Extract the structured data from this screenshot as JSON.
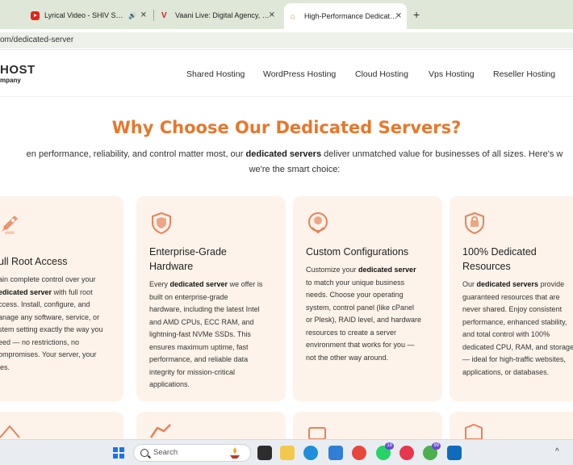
{
  "browser": {
    "tabs": [
      {
        "title": "Lyrical Video - SHIV SE GOR",
        "favicon": "youtube-icon",
        "audio": true
      },
      {
        "title": "Vaani Live: Digital Agency, Web",
        "favicon": "vaani-icon"
      },
      {
        "title": "High-Performance Dedicated S",
        "favicon": "site-icon",
        "active": true
      }
    ],
    "url": "om/dedicated-server"
  },
  "site": {
    "logo": "HOST",
    "logo_sub": "mpany",
    "nav": [
      "Shared Hosting",
      "WordPress Hosting",
      "Cloud Hosting",
      "Vps Hosting",
      "Reseller Hosting"
    ]
  },
  "section": {
    "heading": "Why Choose Our Dedicated Servers?",
    "intro_1": "en performance, reliability, and control matter most, our ",
    "intro_bold": "dedicated servers",
    "intro_2": " deliver unmatched value for businesses of all sizes. Here's w",
    "intro_line2": "we're the smart choice:"
  },
  "cards": [
    {
      "title": "ull Root Access",
      "icon": "rocket-icon",
      "body": [
        {
          "t": "ain complete control over your"
        },
        {
          "b": "edicated server",
          "t": " with full root"
        },
        {
          "t": "ccess. Install, configure, and"
        },
        {
          "t": "anage any software, service, or"
        },
        {
          "t": "stem setting exactly the way you"
        },
        {
          "t": "eed — no restrictions, no"
        },
        {
          "t": "ompromises. Your server, your"
        },
        {
          "t": "les."
        }
      ]
    },
    {
      "title_1": "Enterprise-Grade",
      "title_2": "Hardware",
      "icon": "shield-icon",
      "body": [
        {
          "t": "Every ",
          "b": "dedicated server",
          "t2": " we offer is"
        },
        {
          "t": "built on enterprise-grade"
        },
        {
          "t": "hardware, including the latest Intel"
        },
        {
          "t": "and AMD CPUs, ECC RAM, and"
        },
        {
          "t": "lightning-fast NVMe SSDs. This"
        },
        {
          "t": "ensures maximum uptime, fast"
        },
        {
          "t": "performance, and reliable data"
        },
        {
          "t": "integrity for mission-critical"
        },
        {
          "t": "applications."
        }
      ]
    },
    {
      "title": "Custom Configurations",
      "icon": "badge-check-icon",
      "body": [
        {
          "t": "Customize your ",
          "b": "dedicated server"
        },
        {
          "t": "to match your unique business"
        },
        {
          "t": "needs. Choose your operating"
        },
        {
          "t": "system, control panel (like cPanel"
        },
        {
          "t": "or Plesk), RAID level, and hardware"
        },
        {
          "t": "resources to create a server"
        },
        {
          "t": "environment that works for you —"
        },
        {
          "t": "not the other way around."
        }
      ]
    },
    {
      "title_1": "100% Dedicated",
      "title_2": "Resources",
      "icon": "ssl-shield-icon",
      "body": [
        {
          "t": "Our ",
          "b": "dedicated servers",
          "t2": " provide"
        },
        {
          "t": "guaranteed resources that are"
        },
        {
          "t": "never shared. Enjoy consistent"
        },
        {
          "t": "performance, enhanced stability,"
        },
        {
          "t": "and total control with 100%"
        },
        {
          "t": "dedicated CPU, RAM, and storage"
        },
        {
          "t": "— ideal for high-traffic websites,"
        },
        {
          "t": "applications, or databases."
        }
      ]
    }
  ],
  "taskbar": {
    "search_label": "Search",
    "whatsapp_badge": "19",
    "chrome_badge": "99",
    "tray": "^"
  },
  "colors": {
    "accent": "#e8772a",
    "card_bg": "#fdf3ea",
    "icon": "#e8825a"
  }
}
